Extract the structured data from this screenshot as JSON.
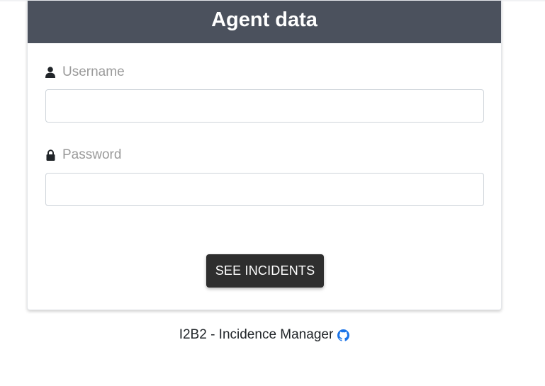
{
  "card": {
    "title": "Agent data"
  },
  "form": {
    "username": {
      "label": "Username",
      "icon": "user-icon",
      "value": "",
      "placeholder": ""
    },
    "password": {
      "label": "Password",
      "icon": "lock-icon",
      "value": "",
      "placeholder": ""
    },
    "submit_label": "SEE INCIDENTS"
  },
  "footer": {
    "text": "I2B2 - Incidence Manager",
    "icon": "github-icon"
  },
  "colors": {
    "header_bg": "#4b515d",
    "button_bg": "#2e2e2e",
    "label_text": "#9a9a9a",
    "github_icon": "#1a73e8"
  }
}
